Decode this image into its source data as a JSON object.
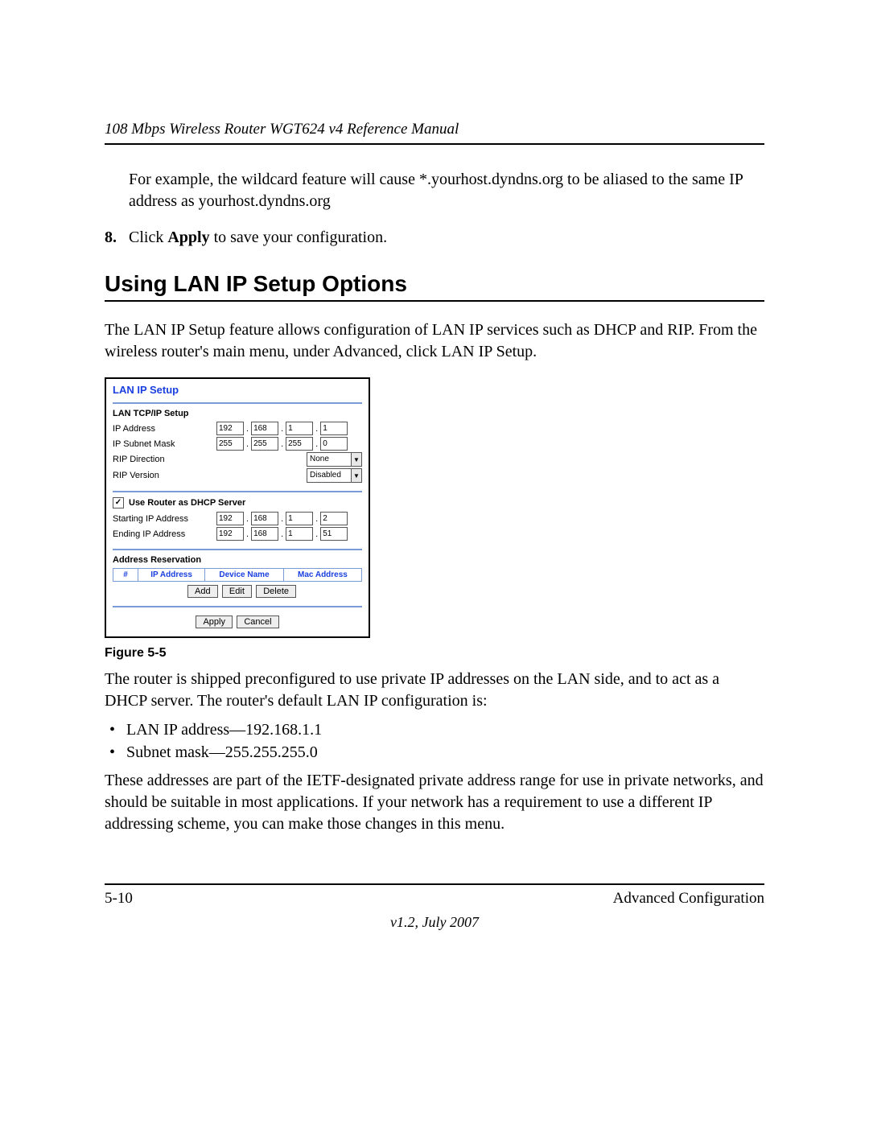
{
  "header": {
    "title": "108 Mbps Wireless Router WGT624 v4 Reference Manual"
  },
  "intro_para": "For example, the wildcard feature will cause *.yourhost.dyndns.org to be aliased to the same IP address as yourhost.dyndns.org",
  "step8": {
    "num": "8.",
    "pre": "Click ",
    "bold": "Apply",
    "post": " to save your configuration."
  },
  "section_heading": "Using LAN IP Setup Options",
  "section_para": "The LAN IP Setup feature allows configuration of LAN IP services such as DHCP and RIP. From the wireless router's main menu, under Advanced, click LAN IP Setup.",
  "screenshot": {
    "title": "LAN IP Setup",
    "tcpip_heading": "LAN TCP/IP Setup",
    "ip_address_label": "IP Address",
    "ip_address": [
      "192",
      "168",
      "1",
      "1"
    ],
    "subnet_label": "IP Subnet Mask",
    "subnet": [
      "255",
      "255",
      "255",
      "0"
    ],
    "rip_dir_label": "RIP Direction",
    "rip_dir_value": "None",
    "rip_ver_label": "RIP Version",
    "rip_ver_value": "Disabled",
    "dhcp_checkbox_label": "Use Router as DHCP Server",
    "start_ip_label": "Starting IP Address",
    "start_ip": [
      "192",
      "168",
      "1",
      "2"
    ],
    "end_ip_label": "Ending IP Address",
    "end_ip": [
      "192",
      "168",
      "1",
      "51"
    ],
    "reservation_heading": "Address Reservation",
    "table_headers": {
      "num": "#",
      "ip": "IP Address",
      "dev": "Device Name",
      "mac": "Mac Address"
    },
    "buttons": {
      "add": "Add",
      "edit": "Edit",
      "delete": "Delete",
      "apply": "Apply",
      "cancel": "Cancel"
    }
  },
  "figure_caption": "Figure 5-5",
  "post_para1": "The router is shipped preconfigured to use private IP addresses on the LAN side, and to act as a DHCP server. The router's default LAN IP configuration is:",
  "bullets": [
    "LAN IP address—192.168.1.1",
    "Subnet mask—255.255.255.0"
  ],
  "post_para2": "These addresses are part of the IETF-designated private address range for use in private networks, and should be suitable in most applications. If your network has a requirement to use a different IP addressing scheme, you can make those changes in this menu.",
  "footer": {
    "left": "5-10",
    "right": "Advanced Configuration",
    "version": "v1.2, July 2007"
  }
}
